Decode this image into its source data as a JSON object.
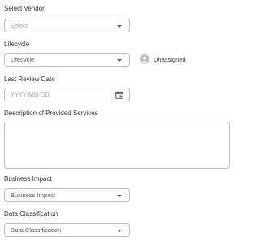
{
  "vendor": {
    "label": "Select Vendor",
    "placeholder": "Select",
    "icon": "chevron-down-icon"
  },
  "lifecycle": {
    "label": "Lifecycle",
    "value": "Lifecycle",
    "icon": "chevron-down-icon"
  },
  "assignee": {
    "label": "Unassigned",
    "icon": "person-icon"
  },
  "last_review": {
    "label": "Last Review Date",
    "placeholder": "YYYY-MM-DD",
    "icon": "calendar-icon"
  },
  "description": {
    "label": "Description of Provided Services",
    "value": ""
  },
  "business_impact": {
    "label": "Business Impact",
    "value": "Business Impact",
    "icon": "chevron-down-icon"
  },
  "data_classification": {
    "label": "Data Classification",
    "value": "Data Classification",
    "icon": "chevron-down-icon"
  }
}
